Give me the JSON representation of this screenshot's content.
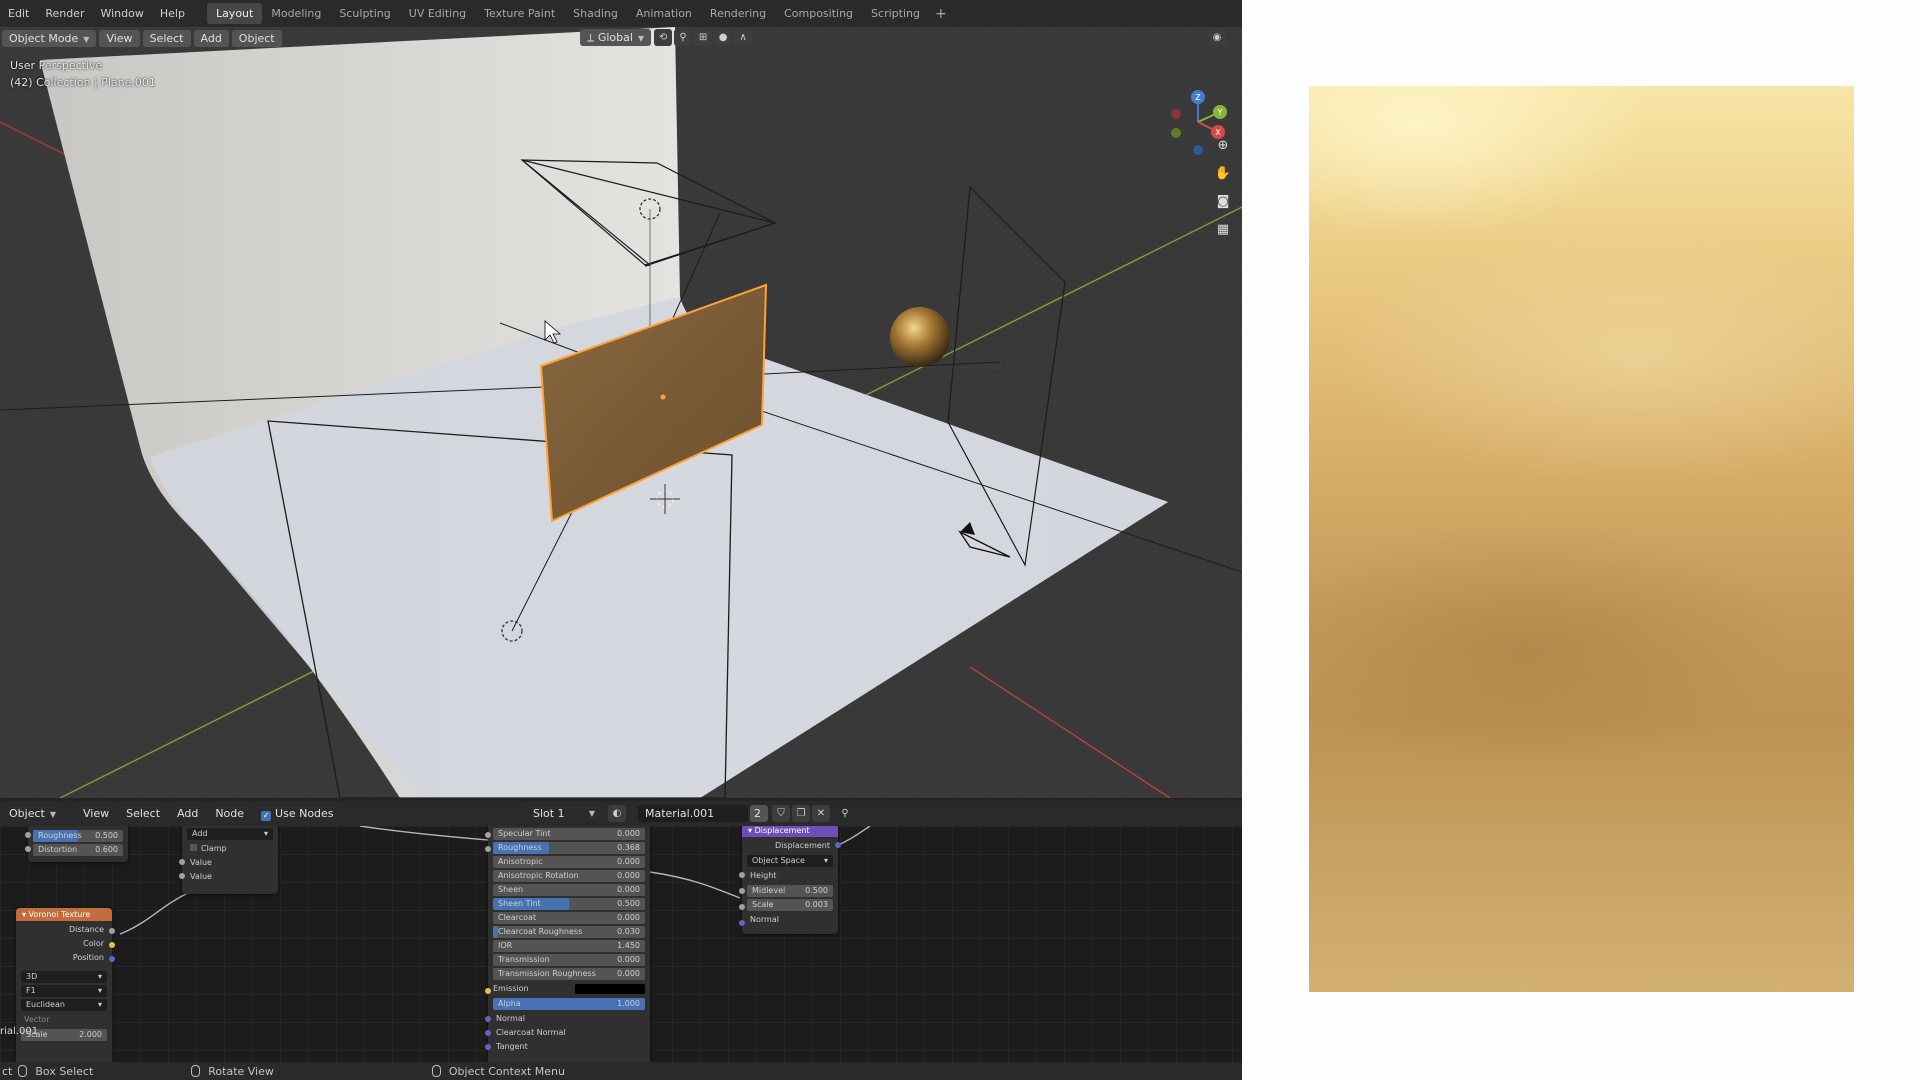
{
  "menubar": {
    "menus": [
      "Edit",
      "Render",
      "Window",
      "Help"
    ],
    "workspaces": [
      "Layout",
      "Modeling",
      "Sculpting",
      "UV Editing",
      "Texture Paint",
      "Shading",
      "Animation",
      "Rendering",
      "Compositing",
      "Scripting"
    ],
    "active_workspace": "Layout",
    "add_label": "+"
  },
  "viewport": {
    "mode": "Object Mode",
    "menus": [
      "View",
      "Select",
      "Add",
      "Object"
    ],
    "orientation": "Global",
    "info_line1": "User Perspective",
    "info_line2": "(42) Collection | Plane.001",
    "gizmo_labels": {
      "z": "Z",
      "y": "Y",
      "x": "X"
    }
  },
  "node_editor": {
    "object_menu": "Object",
    "menus": [
      "View",
      "Select",
      "Add",
      "Node"
    ],
    "use_nodes_label": "Use Nodes",
    "use_nodes_checked": true,
    "slot": "Slot 1",
    "material": "Material.001",
    "user_count": "2",
    "noise_node": {
      "roughness_label": "Roughness",
      "roughness_value": "0.500",
      "roughness_fill": 0.5,
      "distortion_label": "Distortion",
      "distortion_value": "0.600"
    },
    "math_node": {
      "operation": "Add",
      "clamp_label": "Clamp",
      "value1": "Value",
      "value2": "Value"
    },
    "voronoi_node": {
      "title": "Voronoi Texture",
      "outputs": [
        "Distance",
        "Color",
        "Position"
      ],
      "dim": "3D",
      "feature": "F1",
      "metric": "Euclidean",
      "vector_label": "Vector",
      "scale_label": "Scale",
      "scale_value": "2.000",
      "cut_label": "rial.001"
    },
    "bsdf_node": {
      "props": [
        {
          "label": "Specular Tint",
          "value": "0.000",
          "fill": 0
        },
        {
          "label": "Roughness",
          "value": "0.368",
          "fill": 0.368
        },
        {
          "label": "Anisotropic",
          "value": "0.000",
          "fill": 0
        },
        {
          "label": "Anisotropic Rotation",
          "value": "0.000",
          "fill": 0
        },
        {
          "label": "Sheen",
          "value": "0.000",
          "fill": 0
        },
        {
          "label": "Sheen Tint",
          "value": "0.500",
          "fill": 0.5
        },
        {
          "label": "Clearcoat",
          "value": "0.000",
          "fill": 0
        },
        {
          "label": "Clearcoat Roughness",
          "value": "0.030",
          "fill": 0.03
        },
        {
          "label": "IOR",
          "value": "1.450",
          "fill": 0
        },
        {
          "label": "Transmission",
          "value": "0.000",
          "fill": 0
        },
        {
          "label": "Transmission Roughness",
          "value": "0.000",
          "fill": 0
        }
      ],
      "emission_label": "Emission",
      "alpha_label": "Alpha",
      "alpha_value": "1.000",
      "alpha_fill": 1,
      "inputs": [
        "Normal",
        "Clearcoat Normal",
        "Tangent"
      ]
    },
    "displacement_node": {
      "title": "Displacement",
      "output": "Displacement",
      "space": "Object Space",
      "height_label": "Height",
      "midlevel_label": "Midlevel",
      "midlevel_value": "0.500",
      "scale_label": "Scale",
      "scale_value": "0.003",
      "normal_label": "Normal"
    }
  },
  "statusbar": {
    "cut_label": "ct",
    "box_select": "Box Select",
    "rotate_view": "Rotate View",
    "context_menu": "Object Context Menu"
  },
  "colors": {
    "accent_blue": "#4772b3",
    "selection_orange": "#ffa233",
    "voronoi_header": "#c36d3a",
    "displacement_header": "#6e4fb8"
  }
}
